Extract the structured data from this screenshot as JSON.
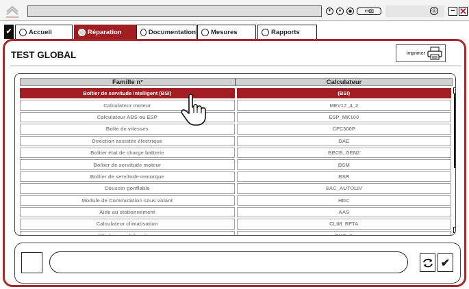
{
  "app": {
    "title_field": "",
    "status_icons": [
      "info-icon",
      "user-icon",
      "network-icon",
      "battery-status-icon"
    ],
    "battery_label": "▭▯▯",
    "right_field": "",
    "help_symbol": "Ⓐ",
    "minimize_symbol": "−",
    "close_symbol": "✕",
    "brand_color": "#a01e22"
  },
  "tabs": [
    {
      "label": "Accueil",
      "active": false
    },
    {
      "label": "Réparation",
      "active": true
    },
    {
      "label": "Documentation",
      "active": false
    },
    {
      "label": "Mesures",
      "active": false
    },
    {
      "label": "Rapports",
      "active": false
    }
  ],
  "page": {
    "title": "TEST GLOBAL",
    "print_label": "Imprimer"
  },
  "table": {
    "headers": [
      "Famille n°",
      "Calculateur"
    ],
    "rows": [
      {
        "famille": "Boîtier de servitude intelligent (BSI)",
        "calculateur": "(BSI)",
        "selected": true
      },
      {
        "famille": "Calculateur moteur",
        "calculateur": "MEV17_4_2",
        "selected": false
      },
      {
        "famille": "Calculateur ABS ou ESP",
        "calculateur": "ESP_MK100",
        "selected": false
      },
      {
        "famille": "Boîte de vitesses",
        "calculateur": "CFC300P",
        "selected": false
      },
      {
        "famille": "Direction assistée électrique",
        "calculateur": "DAE",
        "selected": false
      },
      {
        "famille": "Boîtier état de charge batterie",
        "calculateur": "BECB_GEN2",
        "selected": false
      },
      {
        "famille": "Boîtier de servitude moteur",
        "calculateur": "BSM",
        "selected": false
      },
      {
        "famille": "Boîtier de servitude remorque",
        "calculateur": "BSR",
        "selected": false
      },
      {
        "famille": "Coussin gonflable",
        "calculateur": "SAC_AUTOLIV",
        "selected": false
      },
      {
        "famille": "Module de Commutation sous volant",
        "calculateur": "HDC",
        "selected": false
      },
      {
        "famille": "Aide au stationnement",
        "calculateur": "AAS",
        "selected": false
      },
      {
        "famille": "Calculateur climatisation",
        "calculateur": "CLIM_RFTA",
        "selected": false
      },
      {
        "famille": "Afficheur multifonctions",
        "calculateur": "EMF_C",
        "selected": false
      }
    ]
  },
  "bottom": {
    "message": "",
    "confirm_symbol": "✔"
  }
}
